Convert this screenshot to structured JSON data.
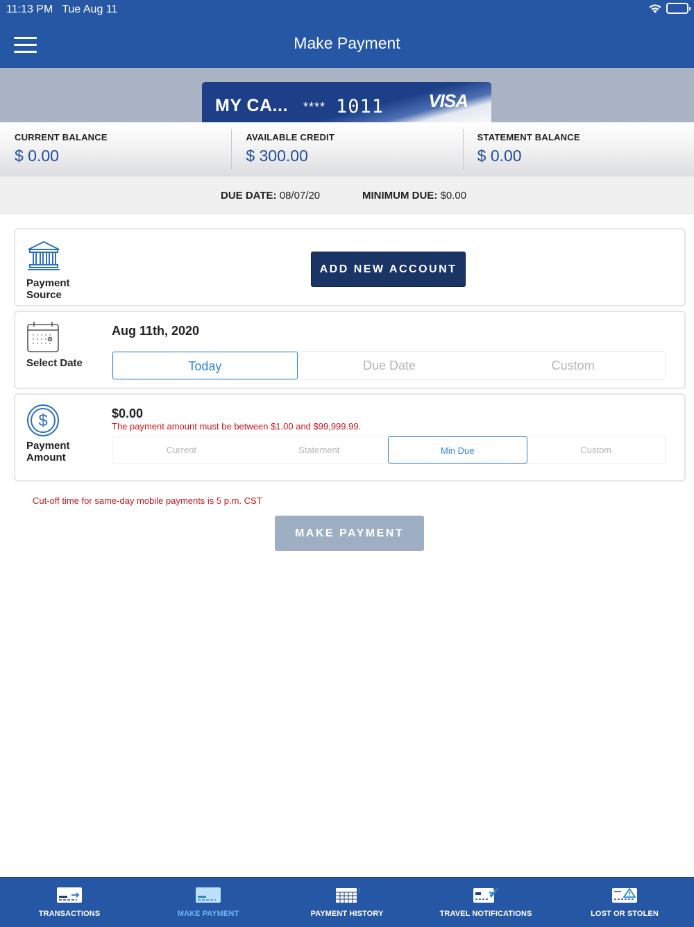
{
  "status_bar": {
    "time": "11:13 PM",
    "date": "Tue Aug 11"
  },
  "header": {
    "title": "Make Payment",
    "menu_icon": "hamburger-menu-icon"
  },
  "card": {
    "name": "MY CA...",
    "mask": "****",
    "last4": "1011",
    "brand": "VISA"
  },
  "balances": [
    {
      "label": "CURRENT BALANCE",
      "value": "$ 0.00"
    },
    {
      "label": "AVAILABLE CREDIT",
      "value": "$ 300.00"
    },
    {
      "label": "STATEMENT BALANCE",
      "value": "$ 0.00"
    }
  ],
  "due": {
    "date_label": "DUE DATE:",
    "date_value": "08/07/20",
    "min_label": "MINIMUM DUE:",
    "min_value": "$0.00"
  },
  "payment_source": {
    "label_line1": "Payment",
    "label_line2": "Source",
    "icon": "bank-icon",
    "add_button": "ADD NEW ACCOUNT"
  },
  "select_date": {
    "label": "Select Date",
    "icon": "calendar-icon",
    "selected_date": "Aug 11th, 2020",
    "options": [
      "Today",
      "Due Date",
      "Custom"
    ],
    "active": "Today"
  },
  "payment_amount": {
    "label_line1": "Payment",
    "label_line2": "Amount",
    "icon": "dollar-circle-icon",
    "value": "$0.00",
    "error": "The payment amount must be between $1.00 and $99,999.99.",
    "options": [
      "Current",
      "Statement",
      "Min Due",
      "Custom"
    ],
    "active": "Min Due"
  },
  "cutoff_notice": "Cut-off time for same-day mobile payments is 5 p.m. CST",
  "make_payment_button": "MAKE PAYMENT",
  "bottom_nav": [
    {
      "label": "TRANSACTIONS",
      "icon": "card-arrow-icon"
    },
    {
      "label": "MAKE PAYMENT",
      "icon": "card-icon",
      "active": true
    },
    {
      "label": "PAYMENT HISTORY",
      "icon": "calendar-grid-icon"
    },
    {
      "label": "TRAVEL NOTIFICATIONS",
      "icon": "card-plane-icon"
    },
    {
      "label": "LOST OR STOLEN",
      "icon": "card-warning-icon"
    }
  ],
  "colors": {
    "header": "#2557a4",
    "accent": "#2d88d6",
    "error": "#c8151e",
    "button_dark": "#1b3466",
    "button_disabled": "#9eafc4",
    "nav_active": "#6fb6f1"
  }
}
